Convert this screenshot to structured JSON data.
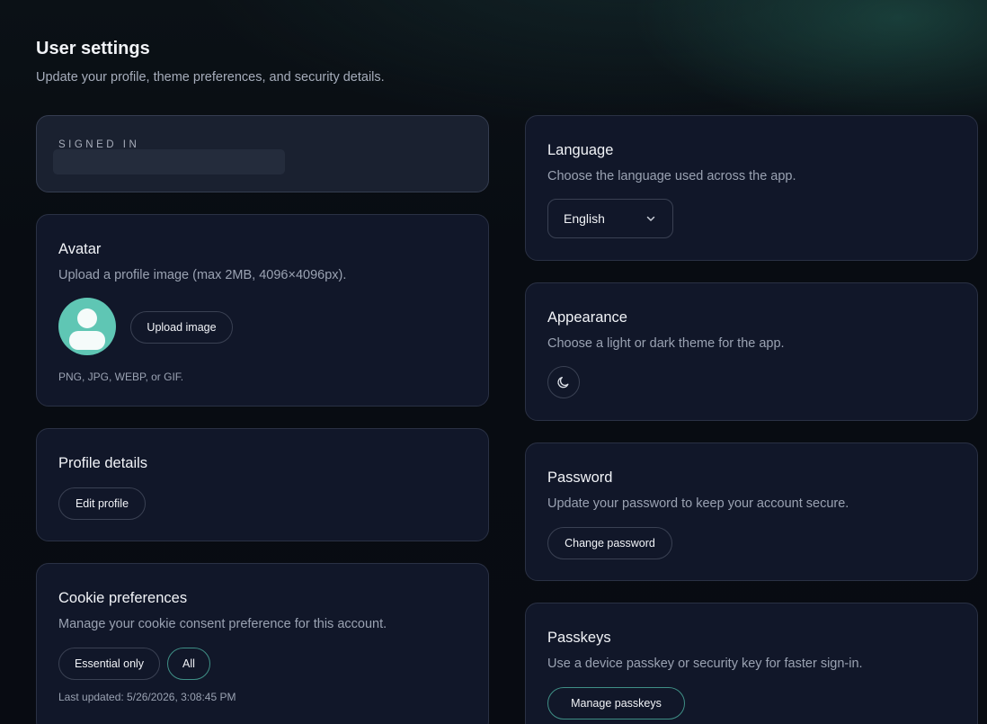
{
  "header": {
    "title": "User settings",
    "subtitle": "Update your profile, theme preferences, and security details."
  },
  "signed_in": {
    "eyebrow": "SIGNED IN"
  },
  "avatar": {
    "title": "Avatar",
    "description": "Upload a profile image (max 2MB, 4096×4096px).",
    "upload_label": "Upload image",
    "formats": "PNG, JPG, WEBP, or GIF.",
    "icon": "user-avatar-icon"
  },
  "profile": {
    "title": "Profile details",
    "edit_label": "Edit profile"
  },
  "cookies": {
    "title": "Cookie preferences",
    "description": "Manage your cookie consent preference for this account.",
    "options": [
      "Essential only",
      "All"
    ],
    "selected": "All",
    "last_updated": "Last updated: 5/26/2026, 3:08:45 PM"
  },
  "language": {
    "title": "Language",
    "description": "Choose the language used across the app.",
    "selected": "English",
    "icon": "chevron-down-icon"
  },
  "appearance": {
    "title": "Appearance",
    "description": "Choose a light or dark theme for the app.",
    "icon": "moon-icon"
  },
  "password": {
    "title": "Password",
    "description": "Update your password to keep your account secure.",
    "change_label": "Change password"
  },
  "passkeys": {
    "title": "Passkeys",
    "description": "Use a device passkey or security key for faster sign-in.",
    "manage_label": "Manage passkeys"
  },
  "colors": {
    "background": "#080b12",
    "card": "#111729",
    "card_border": "#2a3144",
    "accent": "#5fc6b4",
    "accent_border": "#3f8f86",
    "text": "#f1f3f7",
    "muted": "#9aa2b2"
  }
}
